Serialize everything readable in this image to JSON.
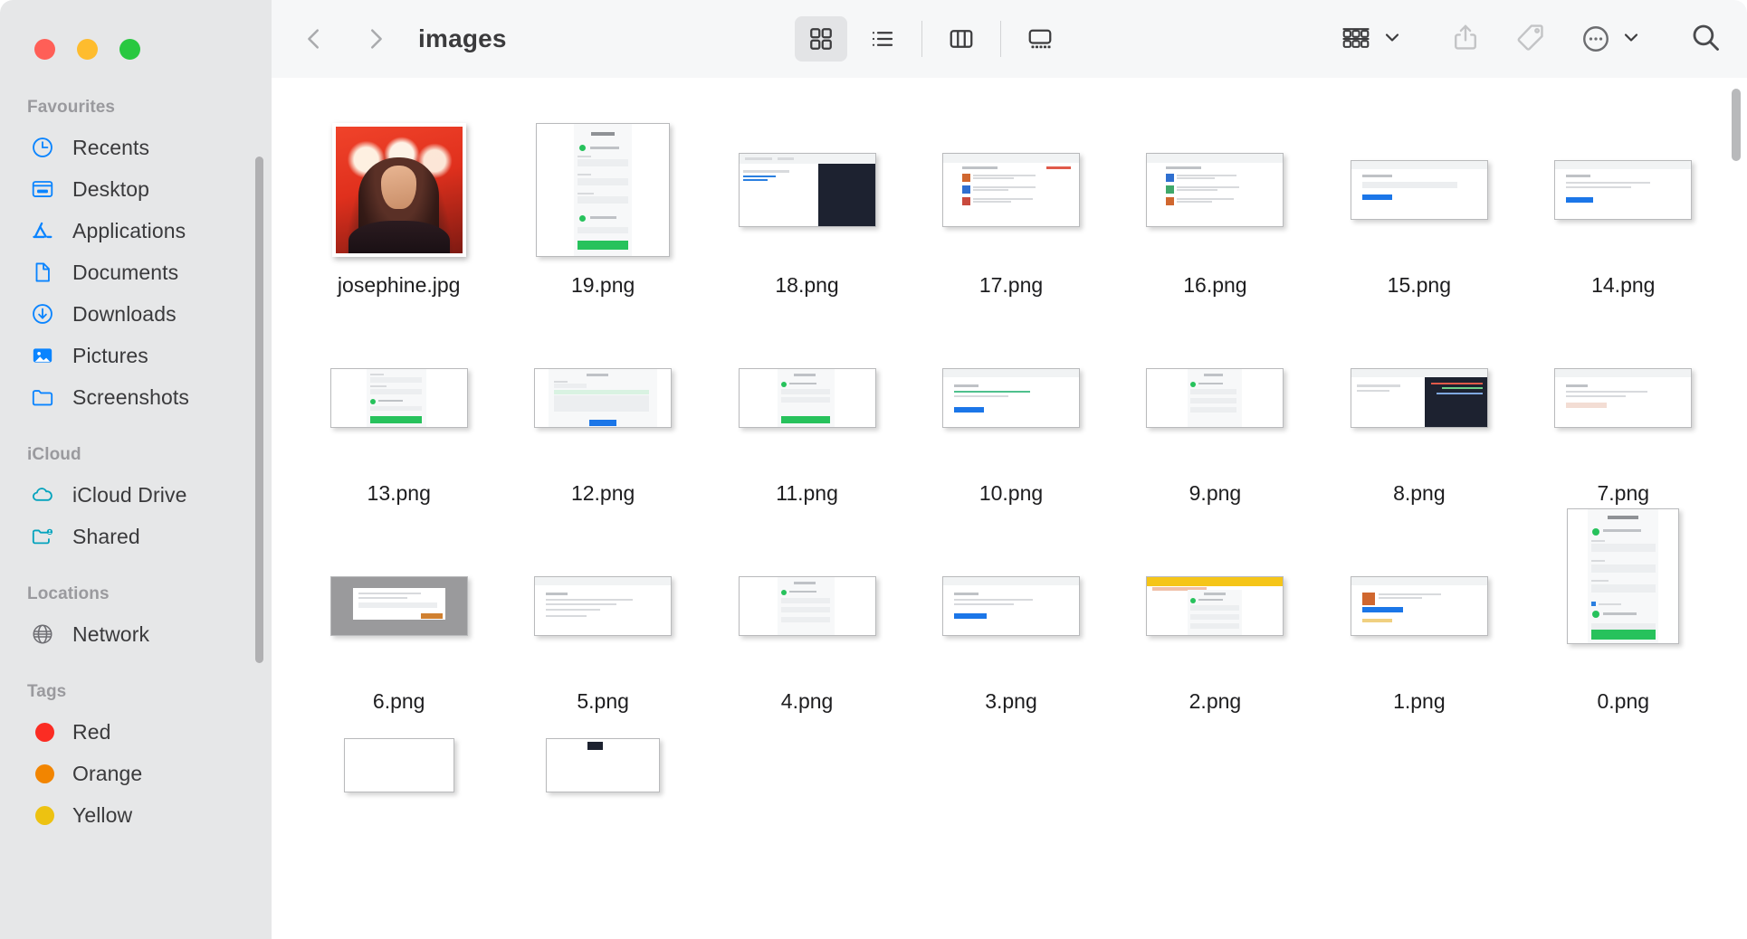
{
  "window": {
    "traffic_lights": [
      {
        "name": "close",
        "color": "#ff5f57"
      },
      {
        "name": "minimize",
        "color": "#febc2e"
      },
      {
        "name": "zoom",
        "color": "#28c840"
      }
    ]
  },
  "toolbar": {
    "back_label": "Back",
    "forward_label": "Forward",
    "title": "images",
    "view_buttons": [
      {
        "name": "icon-view",
        "label": "Icon View",
        "active": true
      },
      {
        "name": "list-view",
        "label": "List View",
        "active": false
      },
      {
        "name": "column-view",
        "label": "Column View",
        "active": false
      },
      {
        "name": "gallery-view",
        "label": "Gallery View",
        "active": false
      }
    ],
    "group_label": "Group",
    "share_label": "Share",
    "tags_label": "Tags",
    "more_label": "More",
    "search_label": "Search"
  },
  "sidebar": {
    "sections": [
      {
        "title": "Favourites",
        "items": [
          {
            "label": "Recents",
            "icon": "clock-icon"
          },
          {
            "label": "Desktop",
            "icon": "desktop-icon"
          },
          {
            "label": "Applications",
            "icon": "applications-icon"
          },
          {
            "label": "Documents",
            "icon": "document-icon"
          },
          {
            "label": "Downloads",
            "icon": "download-icon"
          },
          {
            "label": "Pictures",
            "icon": "pictures-icon"
          },
          {
            "label": "Screenshots",
            "icon": "folder-icon"
          }
        ]
      },
      {
        "title": "iCloud",
        "items": [
          {
            "label": "iCloud Drive",
            "icon": "cloud-icon"
          },
          {
            "label": "Shared",
            "icon": "shared-folder-icon"
          }
        ]
      },
      {
        "title": "Locations",
        "items": [
          {
            "label": "Network",
            "icon": "globe-icon"
          }
        ]
      },
      {
        "title": "Tags",
        "items": [
          {
            "label": "Red",
            "icon": "tag-dot-icon",
            "color": "#fb2c23"
          },
          {
            "label": "Orange",
            "icon": "tag-dot-icon",
            "color": "#f28500"
          },
          {
            "label": "Yellow",
            "icon": "tag-dot-icon",
            "color": "#edc211"
          }
        ]
      }
    ]
  },
  "files": [
    {
      "name": "josephine.jpg",
      "kind": "photo"
    },
    {
      "name": "19.png",
      "kind": "signup-portrait"
    },
    {
      "name": "18.png",
      "kind": "browser-dark-code"
    },
    {
      "name": "17.png",
      "kind": "browser-list-avatars"
    },
    {
      "name": "16.png",
      "kind": "browser-list-avatars"
    },
    {
      "name": "15.png",
      "kind": "browser-form-blue"
    },
    {
      "name": "14.png",
      "kind": "browser-form-blue"
    },
    {
      "name": "13.png",
      "kind": "signup-green"
    },
    {
      "name": "12.png",
      "kind": "dialog-blue"
    },
    {
      "name": "11.png",
      "kind": "signup-green"
    },
    {
      "name": "10.png",
      "kind": "browser-form-blue"
    },
    {
      "name": "9.png",
      "kind": "signup-portrait"
    },
    {
      "name": "8.png",
      "kind": "browser-dark-code"
    },
    {
      "name": "7.png",
      "kind": "browser-form-plain"
    },
    {
      "name": "6.png",
      "kind": "gray-dialog"
    },
    {
      "name": "5.png",
      "kind": "browser-form-plain"
    },
    {
      "name": "4.png",
      "kind": "signup-green"
    },
    {
      "name": "3.png",
      "kind": "browser-form-blue"
    },
    {
      "name": "2.png",
      "kind": "signup-yellow"
    },
    {
      "name": "1.png",
      "kind": "browser-list-avatars"
    },
    {
      "name": "0.png",
      "kind": "signup-tall"
    }
  ]
}
